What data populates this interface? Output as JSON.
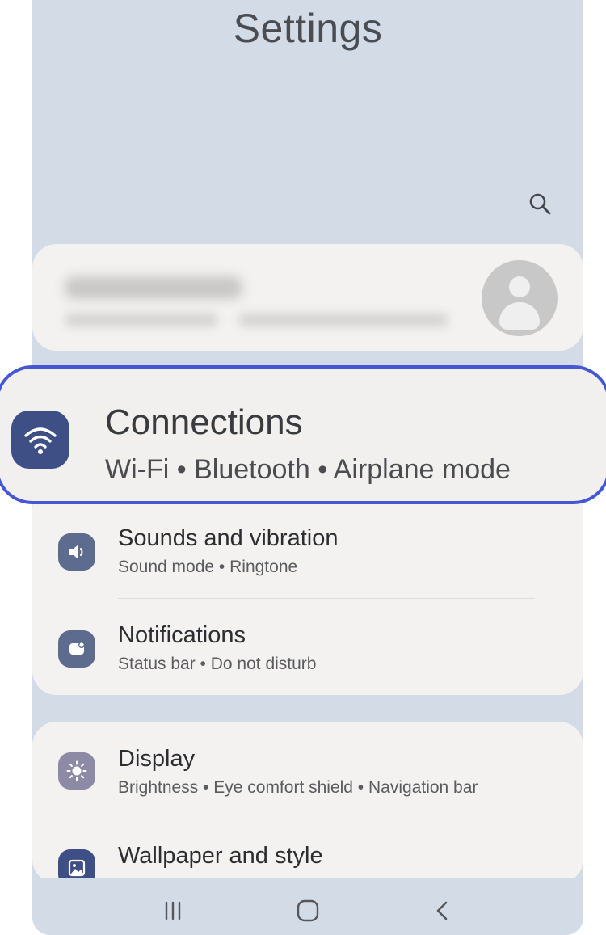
{
  "header": {
    "title": "Settings"
  },
  "colors": {
    "accent_outline": "#4657d6",
    "connections_icon_bg": "#3e4f86",
    "sounds_icon_bg": "#5d6b8f",
    "notifications_icon_bg": "#5d6b8f",
    "display_icon_bg": "#8d8aa6",
    "wallpaper_icon_bg": "#3e4f86",
    "background": "#d3dbe6",
    "card": "#f3f2f0"
  },
  "highlighted_item": {
    "label": "Connections",
    "sub": "Wi-Fi  •  Bluetooth  •  Airplane mode",
    "icon": "wifi-icon"
  },
  "items": [
    {
      "label": "Sounds and vibration",
      "sub": "Sound mode  •  Ringtone",
      "icon": "speaker-icon"
    },
    {
      "label": "Notifications",
      "sub": "Status bar  •  Do not disturb",
      "icon": "notification-icon"
    },
    {
      "label": "Display",
      "sub": "Brightness  •  Eye comfort shield  •  Navigation bar",
      "icon": "sun-icon"
    },
    {
      "label": "Wallpaper and style",
      "sub": "",
      "icon": "image-icon"
    }
  ],
  "navbar": {
    "recents": "recents-icon",
    "home": "home-icon",
    "back": "back-icon"
  }
}
